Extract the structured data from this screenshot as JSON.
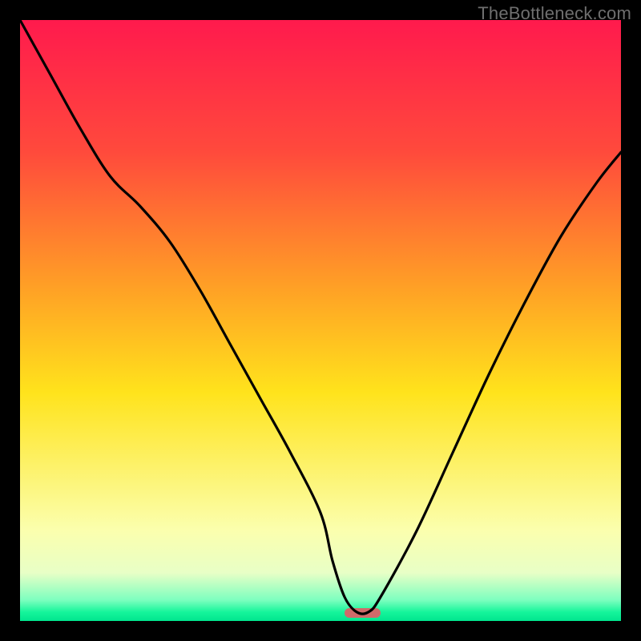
{
  "watermark": "TheBottleneck.com",
  "chart_data": {
    "type": "line",
    "title": "",
    "xlabel": "",
    "ylabel": "",
    "xlim": [
      0,
      100
    ],
    "ylim": [
      0,
      100
    ],
    "x": [
      0,
      5,
      10,
      15,
      20,
      25,
      30,
      35,
      40,
      45,
      50,
      52,
      54,
      56,
      58,
      60,
      66,
      72,
      78,
      84,
      90,
      96,
      100
    ],
    "y": [
      100,
      91,
      82,
      74,
      69,
      63,
      55,
      46,
      37,
      28,
      18,
      10,
      4,
      1.5,
      1.5,
      4,
      15,
      28,
      41,
      53,
      64,
      73,
      78
    ],
    "minimum_marker": {
      "x_start": 54,
      "x_end": 60,
      "color": "#d06a6a"
    },
    "gradient_stops": [
      {
        "offset": 0.0,
        "color": "#ff1a4d"
      },
      {
        "offset": 0.22,
        "color": "#ff4a3c"
      },
      {
        "offset": 0.45,
        "color": "#ffa225"
      },
      {
        "offset": 0.62,
        "color": "#ffe31c"
      },
      {
        "offset": 0.85,
        "color": "#fbffae"
      },
      {
        "offset": 0.92,
        "color": "#e8ffc6"
      },
      {
        "offset": 0.965,
        "color": "#7dffbf"
      },
      {
        "offset": 0.985,
        "color": "#16f59b"
      },
      {
        "offset": 1.0,
        "color": "#00e58e"
      }
    ]
  }
}
